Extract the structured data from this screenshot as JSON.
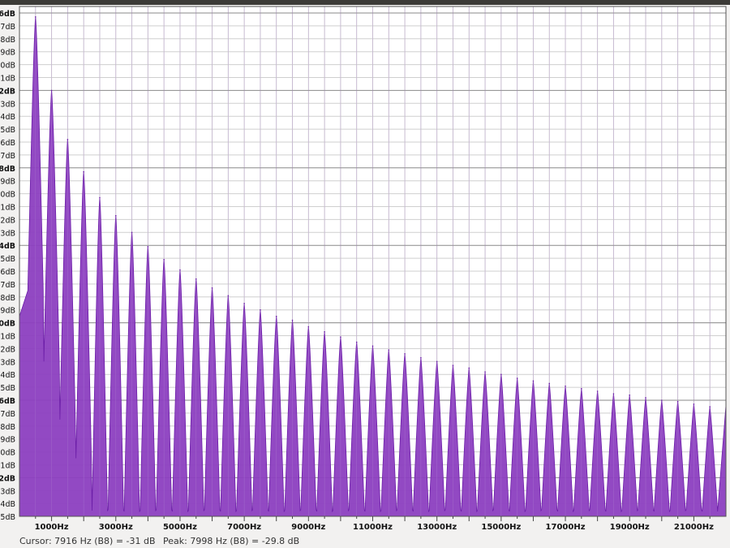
{
  "chart_data": {
    "type": "area",
    "title": "",
    "xlabel": "",
    "ylabel": "",
    "x_scale": "linear",
    "xlim": [
      0,
      22000
    ],
    "ylim": [
      -81,
      -6
    ],
    "grid": true,
    "fill_color": "#8c3fc0",
    "stroke_color": "#6c1ea8",
    "x_ticks": [
      {
        "value": 1000,
        "label": "1000Hz"
      },
      {
        "value": 3000,
        "label": "3000Hz"
      },
      {
        "value": 5000,
        "label": "5000Hz"
      },
      {
        "value": 7000,
        "label": "7000Hz"
      },
      {
        "value": 9000,
        "label": "9000Hz"
      },
      {
        "value": 11000,
        "label": "11000Hz"
      },
      {
        "value": 13000,
        "label": "13000Hz"
      },
      {
        "value": 15000,
        "label": "15000Hz"
      },
      {
        "value": 17000,
        "label": "17000Hz"
      },
      {
        "value": 19000,
        "label": "19000Hz"
      },
      {
        "value": 21000,
        "label": "21000Hz"
      }
    ],
    "y_ticks": [
      {
        "value": -6,
        "label": "6dB",
        "bold": true
      },
      {
        "value": -7,
        "label": "7dB"
      },
      {
        "value": -8,
        "label": "8dB"
      },
      {
        "value": -9,
        "label": "9dB"
      },
      {
        "value": -10,
        "label": "0dB"
      },
      {
        "value": -11,
        "label": "1dB"
      },
      {
        "value": -12,
        "label": "2dB",
        "bold": true
      },
      {
        "value": -13,
        "label": "3dB"
      },
      {
        "value": -14,
        "label": "4dB"
      },
      {
        "value": -15,
        "label": "5dB"
      },
      {
        "value": -16,
        "label": "6dB"
      },
      {
        "value": -17,
        "label": "7dB"
      },
      {
        "value": -18,
        "label": "8dB",
        "bold": true
      },
      {
        "value": -19,
        "label": "9dB"
      },
      {
        "value": -20,
        "label": "0dB"
      },
      {
        "value": -21,
        "label": "1dB"
      },
      {
        "value": -22,
        "label": "2dB"
      },
      {
        "value": -23,
        "label": "3dB"
      },
      {
        "value": -24,
        "label": "4dB",
        "bold": true
      },
      {
        "value": -25,
        "label": "5dB"
      },
      {
        "value": -26,
        "label": "6dB"
      },
      {
        "value": -27,
        "label": "7dB"
      },
      {
        "value": -28,
        "label": "8dB"
      },
      {
        "value": -29,
        "label": "9dB"
      },
      {
        "value": -30,
        "label": "0dB",
        "bold": true
      },
      {
        "value": -31,
        "label": "1dB"
      },
      {
        "value": -32,
        "label": "2dB"
      },
      {
        "value": -33,
        "label": "3dB"
      },
      {
        "value": -34,
        "label": "4dB"
      },
      {
        "value": -35,
        "label": "5dB"
      },
      {
        "value": -36,
        "label": "6dB",
        "bold": true
      },
      {
        "value": -37,
        "label": "7dB"
      },
      {
        "value": -38,
        "label": "8dB"
      },
      {
        "value": -39,
        "label": "9dB"
      },
      {
        "value": -40,
        "label": "0dB"
      },
      {
        "value": -41,
        "label": "1dB"
      },
      {
        "value": -42,
        "label": "2dB",
        "bold": true
      },
      {
        "value": -43,
        "label": "3dB"
      },
      {
        "value": -44,
        "label": "4dB"
      },
      {
        "value": -45,
        "label": "5dB"
      }
    ],
    "harmonics": {
      "fundamental_hz": 500,
      "count": 43,
      "peak_db": [
        -6.3,
        -12.0,
        -15.8,
        -18.3,
        -20.3,
        -21.7,
        -23.0,
        -24.1,
        -25.1,
        -25.9,
        -26.6,
        -27.3,
        -27.9,
        -28.5,
        -29.0,
        -29.5,
        -29.8,
        -30.3,
        -30.7,
        -31.1,
        -31.5,
        -31.8,
        -32.1,
        -32.4,
        -32.7,
        -33.0,
        -33.3,
        -33.5,
        -33.8,
        -34.0,
        -34.3,
        -34.5,
        -34.7,
        -34.9,
        -35.1,
        -35.3,
        -35.5,
        -35.6,
        -35.8,
        -36.0,
        -36.1,
        -36.3,
        -36.5
      ]
    }
  },
  "status": {
    "cursor": "Cursor: 7916 Hz (B8) = -31 dB",
    "peak": "Peak: 7998 Hz (B8) = -29.8 dB"
  }
}
